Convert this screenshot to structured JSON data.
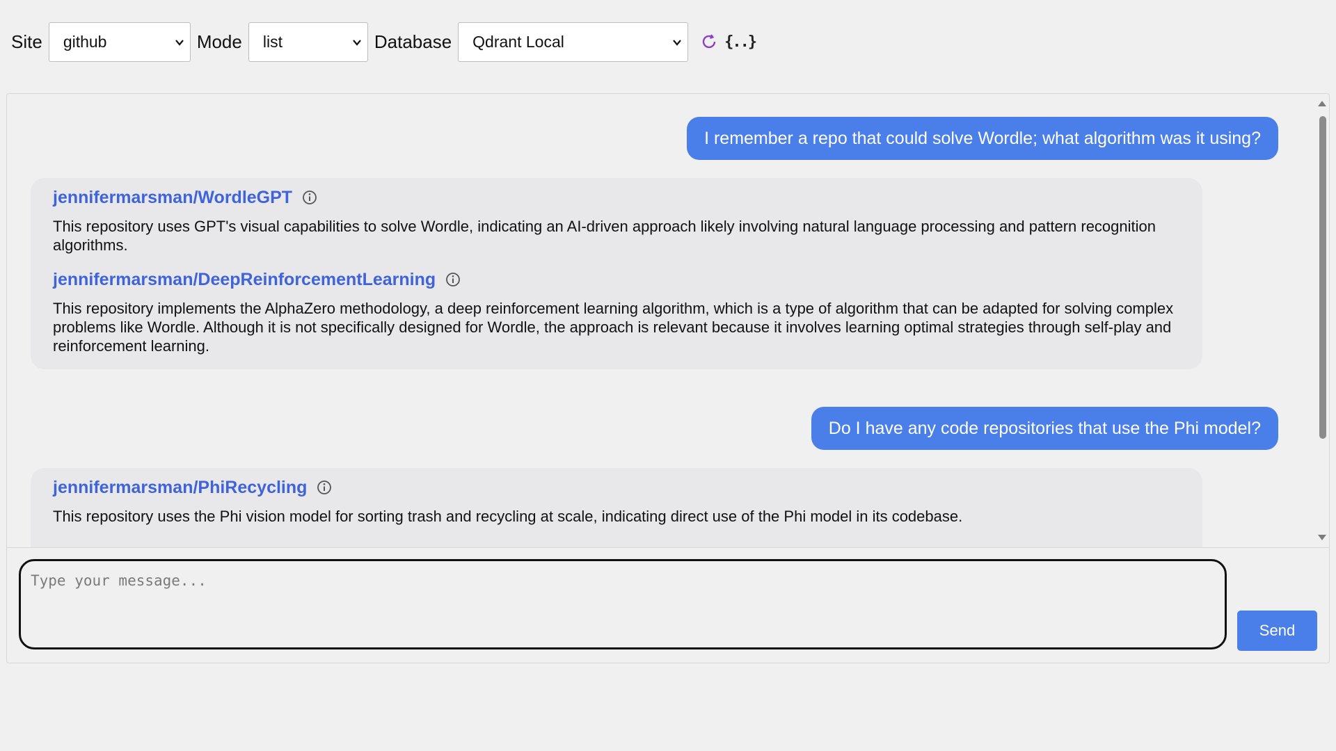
{
  "toolbar": {
    "site_label": "Site",
    "site_value": "github",
    "mode_label": "Mode",
    "mode_value": "list",
    "database_label": "Database",
    "database_value": "Qdrant Local",
    "refresh_icon": "refresh-icon",
    "json_icon_text": "{..}"
  },
  "conversation": {
    "turn1": {
      "user_message": "I remember a repo that could solve Wordle; what algorithm was it using?",
      "results": [
        {
          "repo": "jennifermarsman/WordleGPT",
          "description": "This repository uses GPT's visual capabilities to solve Wordle, indicating an AI-driven approach likely involving natural language processing and pattern recognition algorithms."
        },
        {
          "repo": "jennifermarsman/DeepReinforcementLearning",
          "description": "This repository implements the AlphaZero methodology, a deep reinforcement learning algorithm, which is a type of algorithm that can be adapted for solving complex problems like Wordle. Although it is not specifically designed for Wordle, the approach is relevant because it involves learning optimal strategies through self-play and reinforcement learning."
        }
      ]
    },
    "turn2": {
      "user_message": "Do I have any code repositories that use the Phi model?",
      "results": [
        {
          "repo": "jennifermarsman/PhiRecycling",
          "description": "This repository uses the Phi vision model for sorting trash and recycling at scale, indicating direct use of the Phi model in its codebase."
        }
      ]
    }
  },
  "composer": {
    "placeholder": "Type your message...",
    "send_label": "Send"
  },
  "colors": {
    "accent": "#4a7ee8",
    "link": "#3f63d8",
    "refresh_icon": "#8b3fc9",
    "card_background": "#e8e8ea",
    "page_background": "#f0f0f1"
  }
}
